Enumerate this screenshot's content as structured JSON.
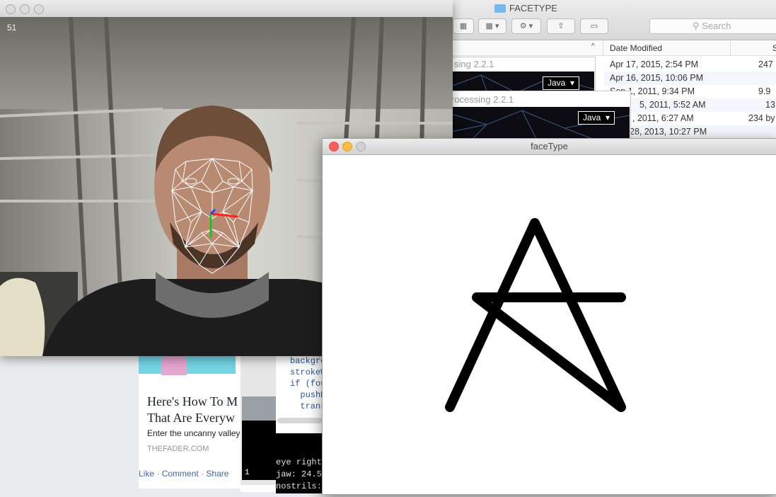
{
  "facebook_post": {
    "headline_line1": "Here's How To M",
    "headline_line2": "That Are Everyw",
    "subtitle": "Enter the uncanny valley",
    "source": "THEFADER.COM",
    "actions": {
      "like": "Like",
      "comment": "Comment",
      "share": "Share",
      "separator": "·"
    }
  },
  "processing_editor": {
    "code_lines": [
      "backgro",
      "strokeW",
      "if (fou",
      "  pushM",
      "  trans"
    ],
    "line_number": "1",
    "console_lines": [
      "eye right",
      "jaw: 24.59",
      "nostrils:"
    ]
  },
  "finder": {
    "title": "FACETYPE",
    "search_placeholder": "Search",
    "column_sort_indicator": "^",
    "column_date_modified": "Date Modified",
    "column_size_partial": "S",
    "rows": [
      {
        "date": "Apr 17, 2015, 2:54 PM",
        "size": "247"
      },
      {
        "date": "Apr 16, 2015, 10:06 PM",
        "size": ""
      },
      {
        "date": "Sep 1, 2011, 9:34 PM",
        "size": "9.9"
      },
      {
        "date": "5, 2011, 5:52 AM",
        "size": "13"
      },
      {
        "date": ", 2011, 6:27 AM",
        "size": "234 by"
      },
      {
        "date": "28, 2013, 10:27 PM",
        "size": ""
      }
    ]
  },
  "processing_launchers": [
    {
      "title": "sing 2.2.1",
      "mode": "Java"
    },
    {
      "title": "rocessing 2.2.1",
      "mode": "Java"
    }
  ],
  "webcam": {
    "frame_counter": "51"
  },
  "facetype_window": {
    "title": "faceType",
    "drawn_letter": "A"
  },
  "colors": {
    "close": "#fc605c",
    "minimize": "#fdbc40",
    "zoom": "#34c84a",
    "fb_link": "#4267b2",
    "pose_x": "#ff2020",
    "pose_y": "#20c020",
    "pose_z": "#2040ff"
  }
}
